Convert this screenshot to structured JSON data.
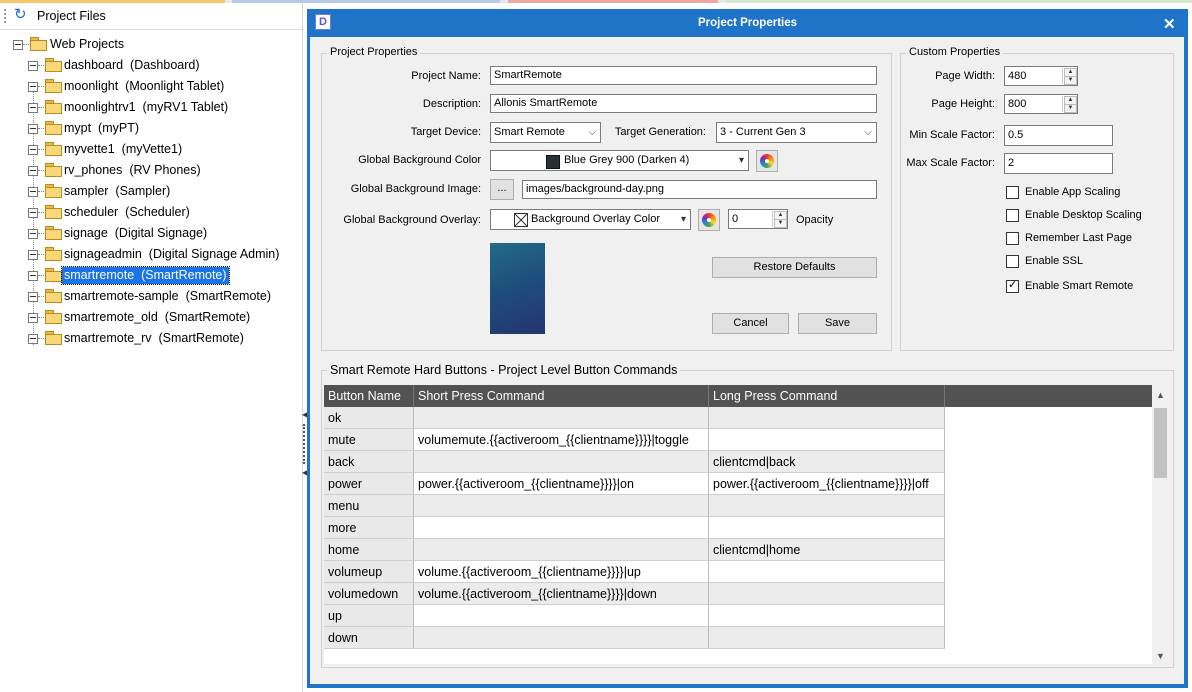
{
  "left_panel": {
    "title": "Project Files",
    "root": "Web Projects",
    "items": [
      {
        "name": "dashboard",
        "desc": "(Dashboard)"
      },
      {
        "name": "moonlight",
        "desc": "(Moonlight Tablet)"
      },
      {
        "name": "moonlightrv1",
        "desc": "(myRV1 Tablet)"
      },
      {
        "name": "mypt",
        "desc": "(myPT)"
      },
      {
        "name": "myvette1",
        "desc": "(myVette1)"
      },
      {
        "name": "rv_phones",
        "desc": "(RV Phones)"
      },
      {
        "name": "sampler",
        "desc": "(Sampler)"
      },
      {
        "name": "scheduler",
        "desc": "(Scheduler)"
      },
      {
        "name": "signage",
        "desc": "(Digital Signage)"
      },
      {
        "name": "signageadmin",
        "desc": "(Digital Signage Admin)"
      },
      {
        "name": "smartremote",
        "desc": "(SmartRemote)"
      },
      {
        "name": "smartremote-sample",
        "desc": "(SmartRemote)"
      },
      {
        "name": "smartremote_old",
        "desc": "(SmartRemote)"
      },
      {
        "name": "smartremote_rv",
        "desc": "(SmartRemote)"
      }
    ],
    "selected_index": 10
  },
  "dialog": {
    "title": "Project Properties",
    "app_icon_letter": "D",
    "close_glyph": "✕",
    "project_properties": {
      "group_title": "Project Properties",
      "project_name_label": "Project Name:",
      "project_name": "SmartRemote",
      "description_label": "Description:",
      "description": "Allonis SmartRemote",
      "target_device_label": "Target Device:",
      "target_device": "Smart Remote",
      "target_generation_label": "Target Generation:",
      "target_generation": "3 - Current Gen 3",
      "bg_color_label": "Global Background Color",
      "bg_color": "Blue Grey 900 (Darken 4)",
      "bg_color_hex": "#263238",
      "bg_image_label": "Global Background Image:",
      "bg_image_browse": "...",
      "bg_image": "images/background-day.png",
      "bg_overlay_label": "Global Background Overlay:",
      "bg_overlay": "Background Overlay Color",
      "opacity_value": "0",
      "opacity_label": "Opacity",
      "restore_defaults": "Restore Defaults",
      "cancel": "Cancel",
      "save": "Save"
    },
    "custom_properties": {
      "group_title": "Custom Properties",
      "page_width_label": "Page Width:",
      "page_width": "480",
      "page_height_label": "Page Height:",
      "page_height": "800",
      "min_scale_label": "Min Scale Factor:",
      "min_scale": "0.5",
      "max_scale_label": "Max Scale Factor:",
      "max_scale": "2",
      "checkboxes": [
        {
          "label": "Enable App Scaling",
          "checked": false
        },
        {
          "label": "Enable Desktop Scaling",
          "checked": false
        },
        {
          "label": "Remember Last Page",
          "checked": false
        },
        {
          "label": "Enable SSL",
          "checked": false
        },
        {
          "label": "Enable Smart Remote",
          "checked": true
        }
      ]
    },
    "hard_buttons": {
      "group_title": "Smart Remote Hard Buttons - Project Level Button Commands",
      "columns": [
        "Button Name",
        "Short Press Command",
        "Long Press Command"
      ],
      "rows": [
        [
          "ok",
          "",
          ""
        ],
        [
          "mute",
          "volumemute.{{activeroom_{{clientname}}}}|toggle",
          ""
        ],
        [
          "back",
          "",
          "clientcmd|back"
        ],
        [
          "power",
          "power.{{activeroom_{{clientname}}}}|on",
          "power.{{activeroom_{{clientname}}}}|off"
        ],
        [
          "menu",
          "",
          ""
        ],
        [
          "more",
          "",
          ""
        ],
        [
          "home",
          "",
          "clientcmd|home"
        ],
        [
          "volumeup",
          "volume.{{activeroom_{{clientname}}}}|up",
          ""
        ],
        [
          "volumedown",
          "volume.{{activeroom_{{clientname}}}}|down",
          ""
        ],
        [
          "up",
          "",
          ""
        ],
        [
          "down",
          "",
          ""
        ]
      ]
    }
  }
}
